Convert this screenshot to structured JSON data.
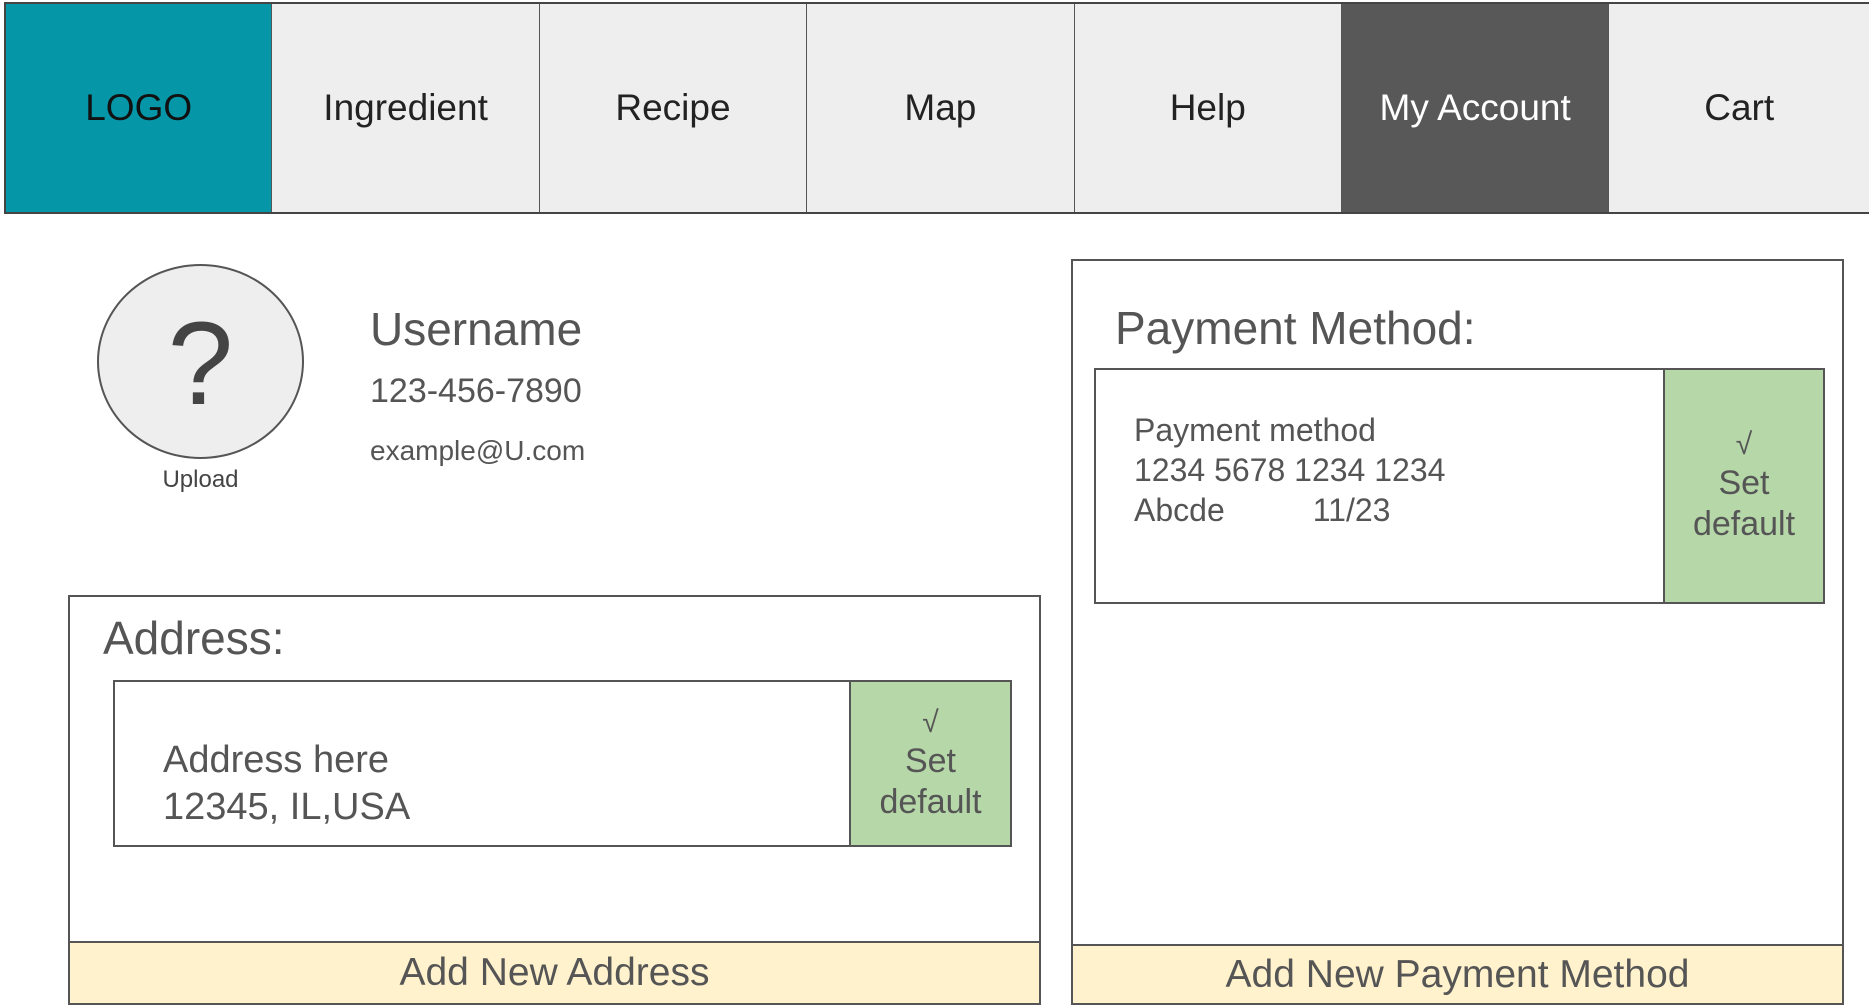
{
  "nav": {
    "items": [
      {
        "label": "LOGO"
      },
      {
        "label": "Ingredient"
      },
      {
        "label": "Recipe"
      },
      {
        "label": "Map"
      },
      {
        "label": "Help"
      },
      {
        "label": "My Account",
        "active": true
      },
      {
        "label": "Cart"
      }
    ]
  },
  "profile": {
    "avatar_glyph": "?",
    "upload_label": "Upload",
    "username": "Username",
    "phone": "123-456-7890",
    "email": "example@U.com"
  },
  "address": {
    "title": "Address:",
    "entry_line1": "Address here",
    "entry_line2": "12345, IL,USA",
    "set_default_check": "√",
    "set_default_line1": "Set",
    "set_default_line2": "default",
    "add_button": "Add New Address"
  },
  "payment": {
    "title": "Payment Method:",
    "entry_line1": "Payment method",
    "card_number": "1234 5678 1234 1234",
    "holder_name": "Abcde",
    "expiry": "11/23",
    "set_default_check": "√",
    "set_default_line1": "Set",
    "set_default_line2": "default",
    "add_button": "Add New Payment Method"
  },
  "colors": {
    "logo_bg": "#0596a8",
    "active_tab_bg": "#585858",
    "tab_bg": "#eeeeee",
    "default_btn_bg": "#b6d7a8",
    "add_btn_bg": "#fff2cc"
  }
}
